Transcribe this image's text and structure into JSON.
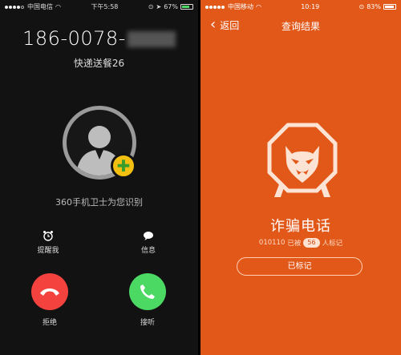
{
  "left": {
    "status": {
      "carrier": "中国电信",
      "time": "下午5:58",
      "battery": "67%",
      "signal_strength": 4
    },
    "call": {
      "number_visible": "186-0078-",
      "caller_tag": "快递送餐26",
      "identify_text": "360手机卫士为您识别"
    },
    "actions": {
      "remind": "提醒我",
      "message": "信息",
      "decline": "拒绝",
      "accept": "接听"
    },
    "colors": {
      "decline": "#f4433e",
      "accept": "#4bd964",
      "badge": "#f3c012"
    },
    "icons": [
      "alarm-icon",
      "message-icon",
      "hangup-icon",
      "phone-icon",
      "person-icon",
      "plus-icon"
    ]
  },
  "right": {
    "status": {
      "carrier": "中国移动",
      "time": "10:19",
      "battery": "83%",
      "signal_strength": 4
    },
    "nav": {
      "back": "返回",
      "title": "查询结果"
    },
    "verdict": "诈骗电话",
    "number": "010110",
    "marked_prefix": "已被",
    "marked_count": "56",
    "marked_suffix": "人标记",
    "marked_button": "已标记",
    "colors": {
      "background": "#e15819"
    },
    "icons": [
      "chevron-left-icon",
      "devil-shield-icon"
    ]
  }
}
